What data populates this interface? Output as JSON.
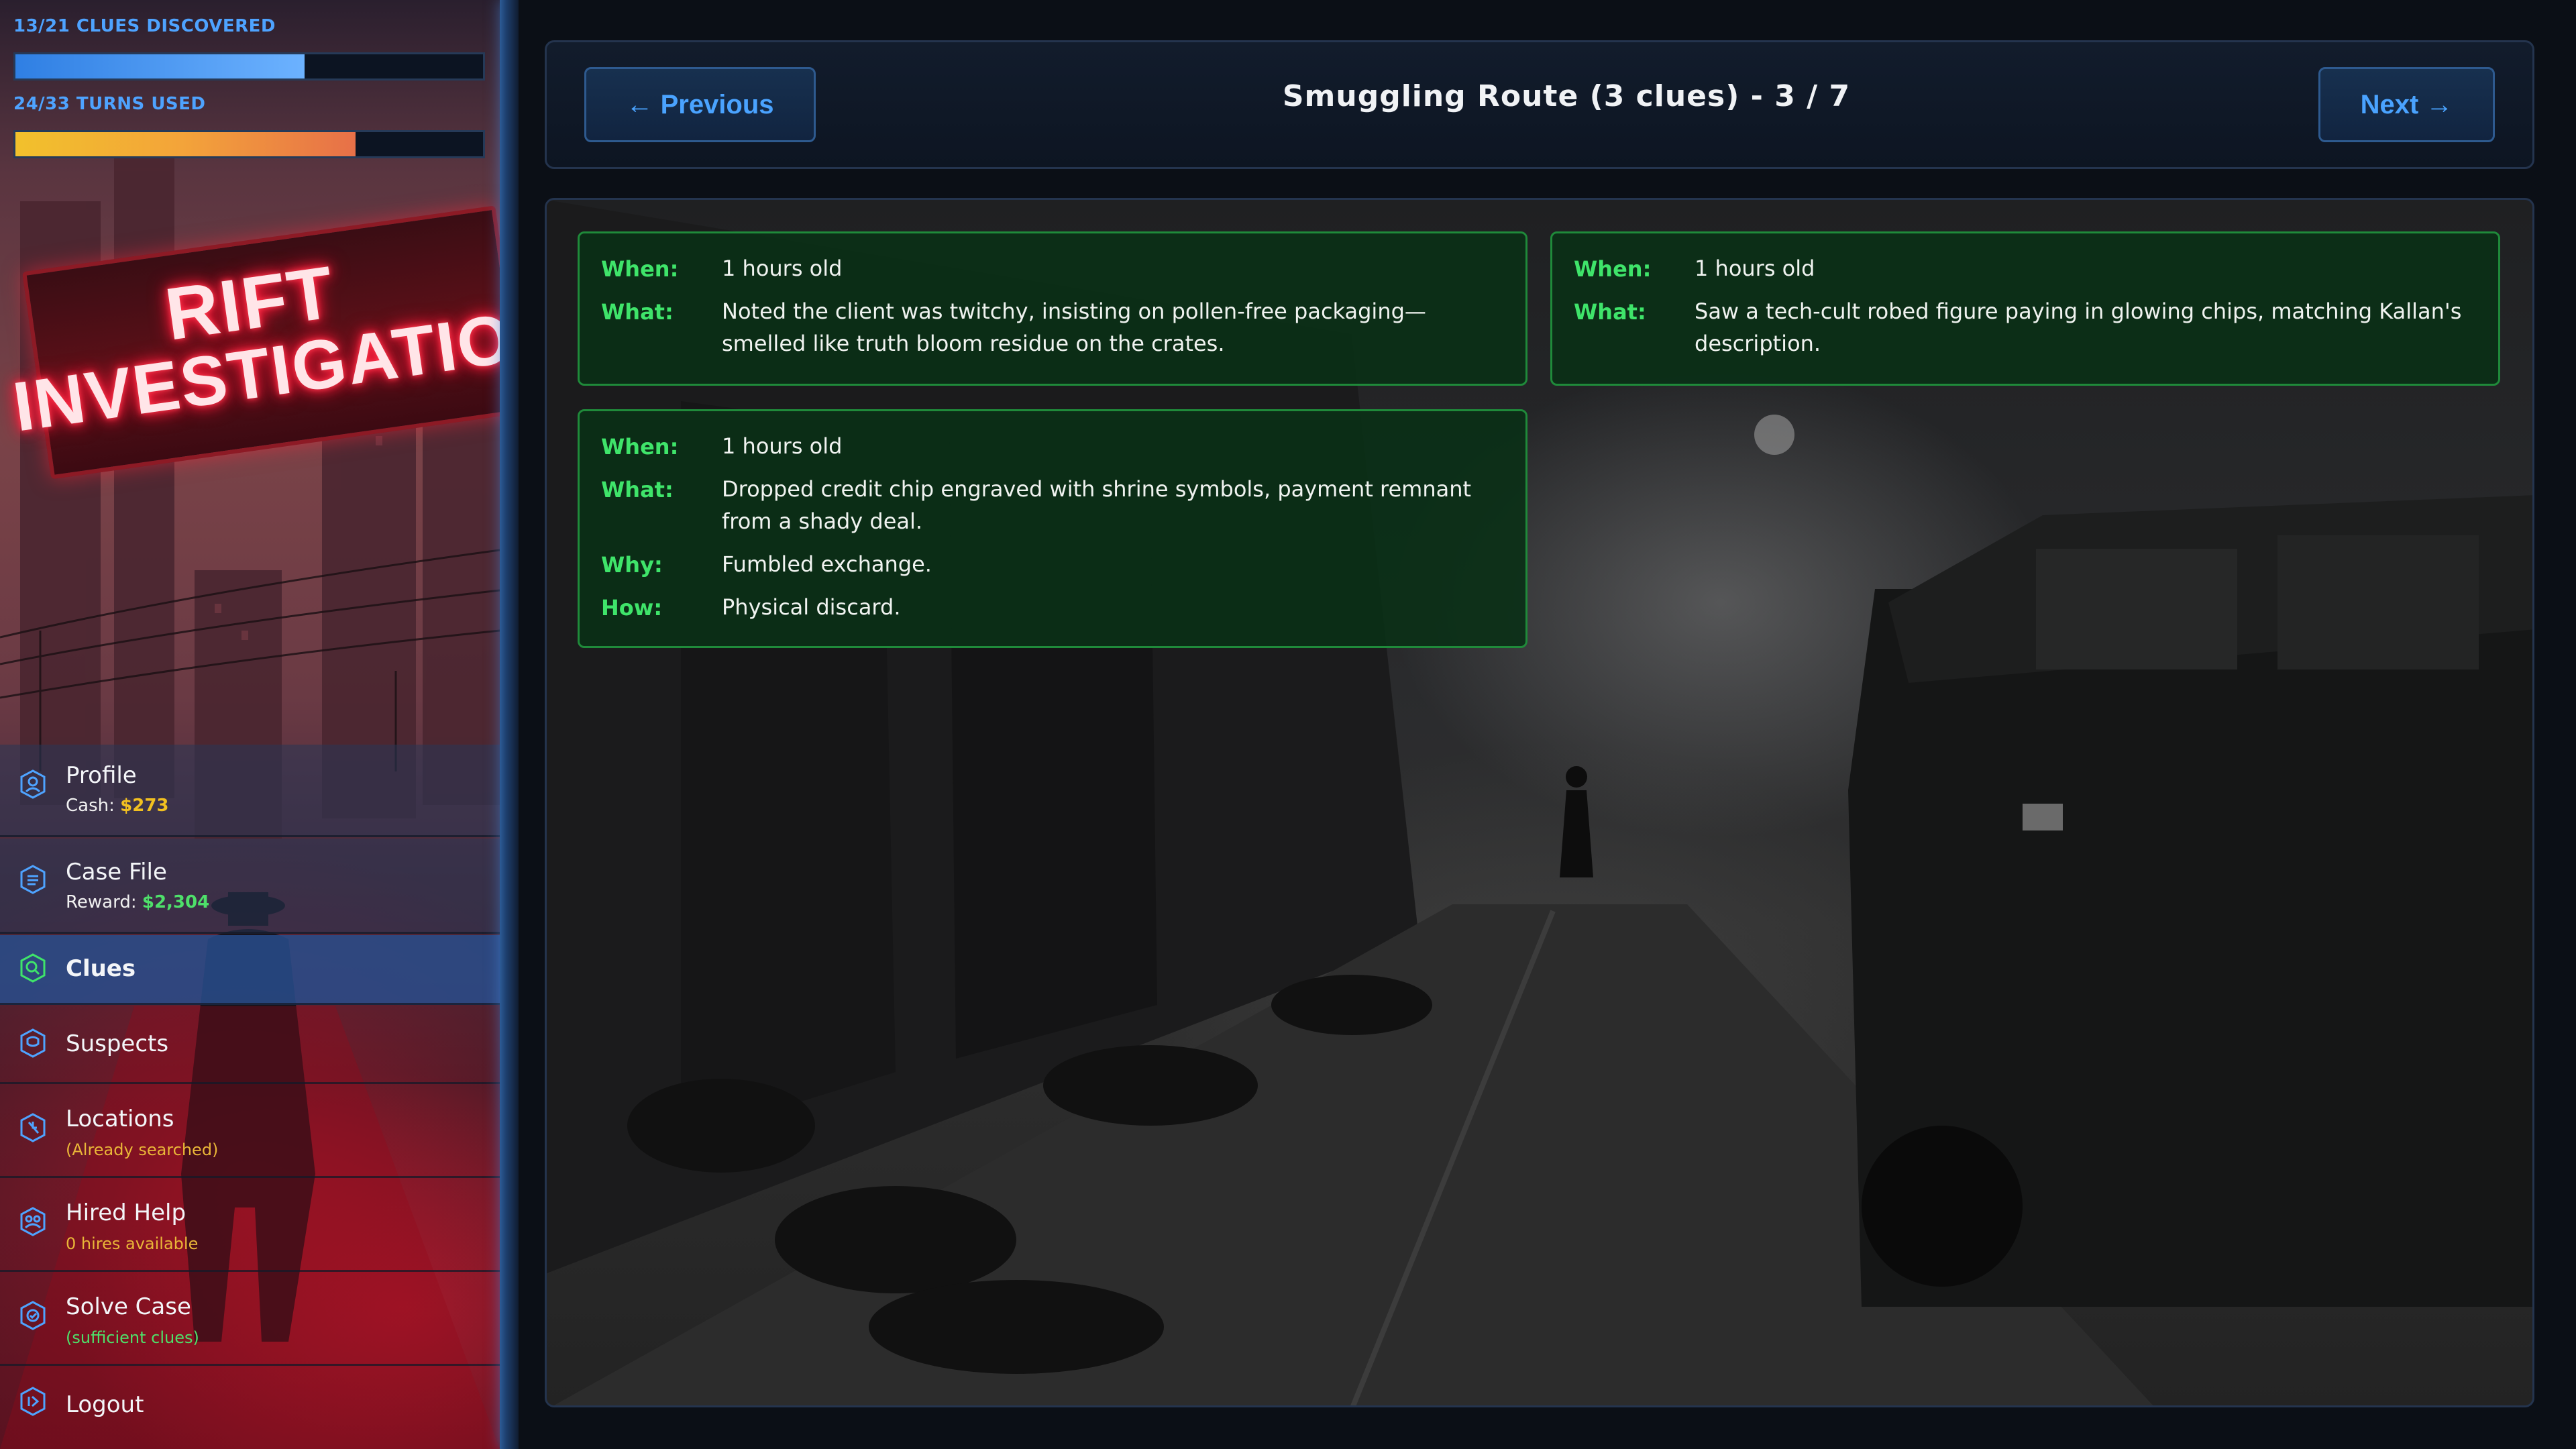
{
  "stats": {
    "clues_label": "13/21 CLUES DISCOVERED",
    "clues_fraction": 0.619,
    "turns_label": "24/33 TURNS USED",
    "turns_fraction": 0.727
  },
  "logo": {
    "line1": "RIFT",
    "line2": "INVESTIGATIONS"
  },
  "sidebar": {
    "profile": {
      "label": "Profile",
      "sub_prefix": "Cash: ",
      "sub_value": "$273"
    },
    "case_file": {
      "label": "Case File",
      "sub_prefix": "Reward: ",
      "sub_value": "$2,304"
    },
    "clues": {
      "label": "Clues"
    },
    "suspects": {
      "label": "Suspects"
    },
    "locations": {
      "label": "Locations",
      "sub": "(Already searched)"
    },
    "hired_help": {
      "label": "Hired Help",
      "sub": "0 hires available"
    },
    "solve_case": {
      "label": "Solve Case",
      "sub": "(sufficient clues)"
    },
    "logout": {
      "label": "Logout"
    }
  },
  "header": {
    "prev_label": "← Previous",
    "title": "Smuggling Route (3 clues) - 3 / 7",
    "next_label": "Next →"
  },
  "labels": {
    "when": "When:",
    "what": "What:",
    "why": "Why:",
    "how": "How:"
  },
  "clues": [
    {
      "when": "1 hours old",
      "what": "Noted the client was twitchy, insisting on pollen-free packaging—smelled like truth bloom residue on the crates."
    },
    {
      "when": "1 hours old",
      "what": "Saw a tech-cult robed figure paying in glowing chips, matching Kallan's description."
    },
    {
      "when": "1 hours old",
      "what": "Dropped credit chip engraved with shrine symbols, payment remnant from a shady deal.",
      "why": "Fumbled exchange.",
      "how": "Physical discard."
    }
  ],
  "colors": {
    "accent_blue": "#4ea3ff",
    "clue_green": "#3fe46a",
    "cash_yellow": "#f2c020",
    "reward_green": "#4ee06a"
  }
}
